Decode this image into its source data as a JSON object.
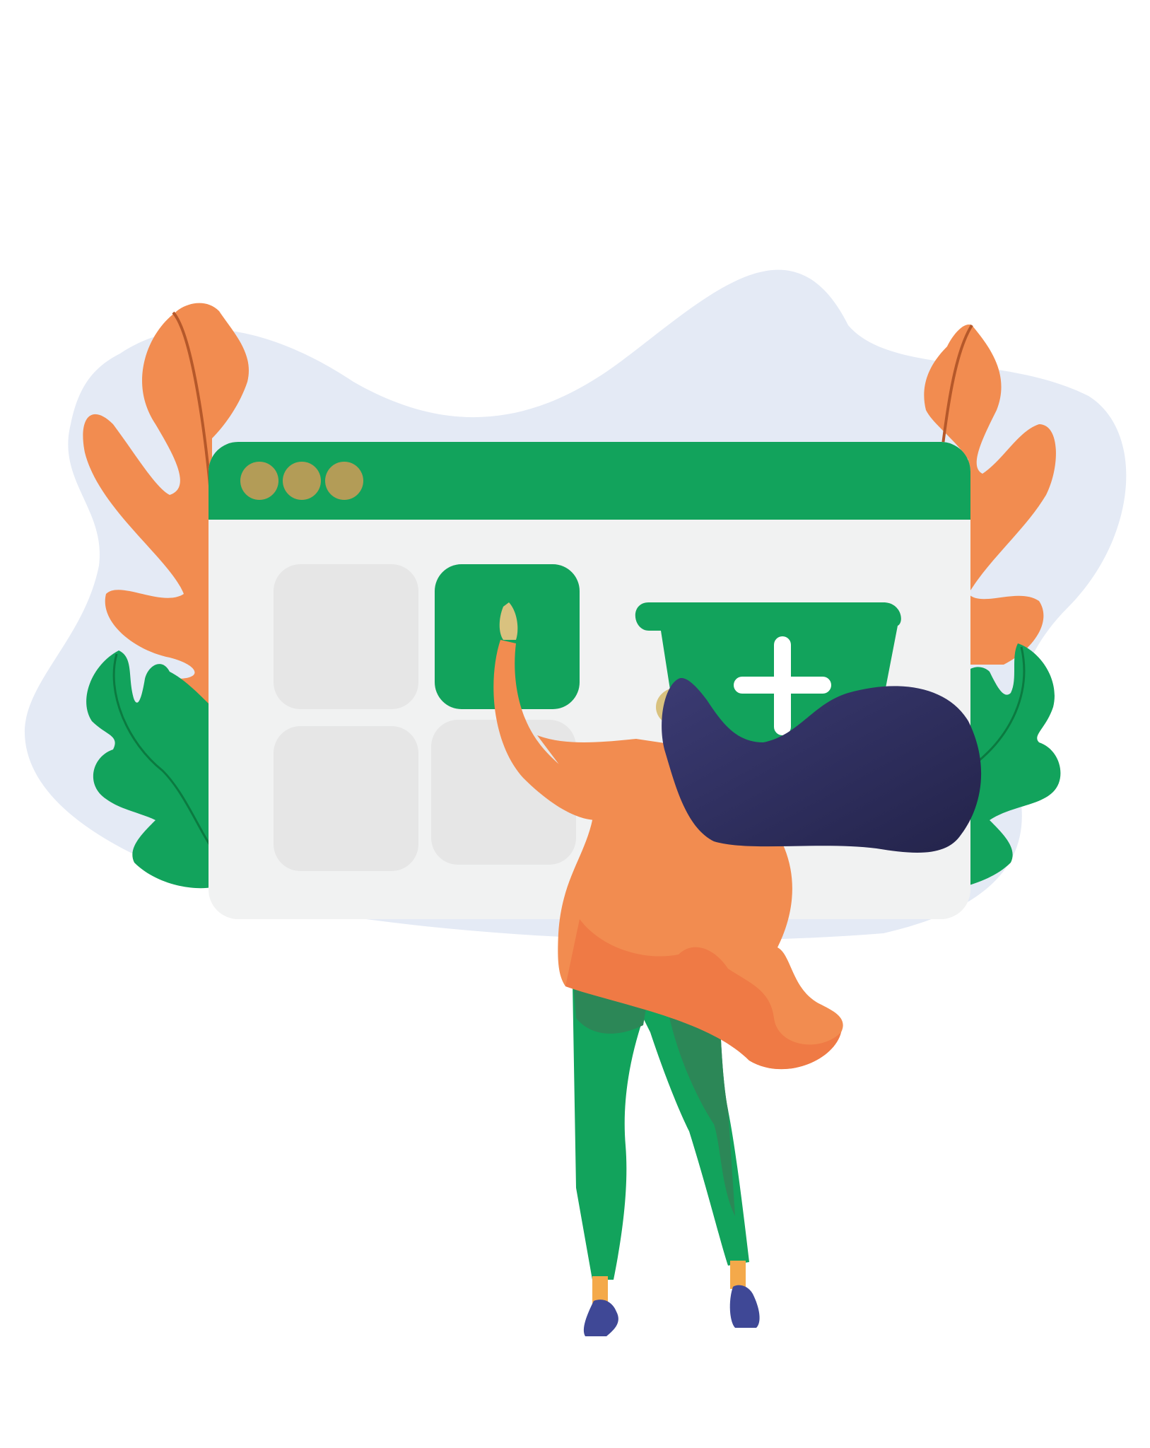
{
  "colors": {
    "background": "#ffffff",
    "blob": "#e4eaf5",
    "window_frame": "#12a35c",
    "window_body": "#f1f2f2",
    "tile_gray": "#e6e6e6",
    "tile_active": "#12a35c",
    "window_dots": "#b39c57",
    "leaf_orange": "#f28c50",
    "leaf_vein": "#b5582a",
    "leaf_green": "#12a35c",
    "leaf_green_vein": "#0b7a40",
    "cart": "#12a35c",
    "cart_plus": "#ffffff",
    "person_top": "#f28c50",
    "person_top_shade": "#ef7a45",
    "person_pants": "#12a35c",
    "person_pants_shade": "#2c8757",
    "person_hair": "#2b2b5a",
    "person_skin": "#d9c27f",
    "person_shoes": "#3f4896",
    "person_socks": "#f4a94a"
  },
  "illustration": {
    "window": {
      "traffic_dots": [
        "dot-1",
        "dot-2",
        "dot-3"
      ],
      "tiles": [
        "tile-1",
        "tile-2-active",
        "tile-3",
        "tile-4"
      ]
    },
    "icons": [
      "shopping-cart-add-icon",
      "plus-icon"
    ]
  }
}
